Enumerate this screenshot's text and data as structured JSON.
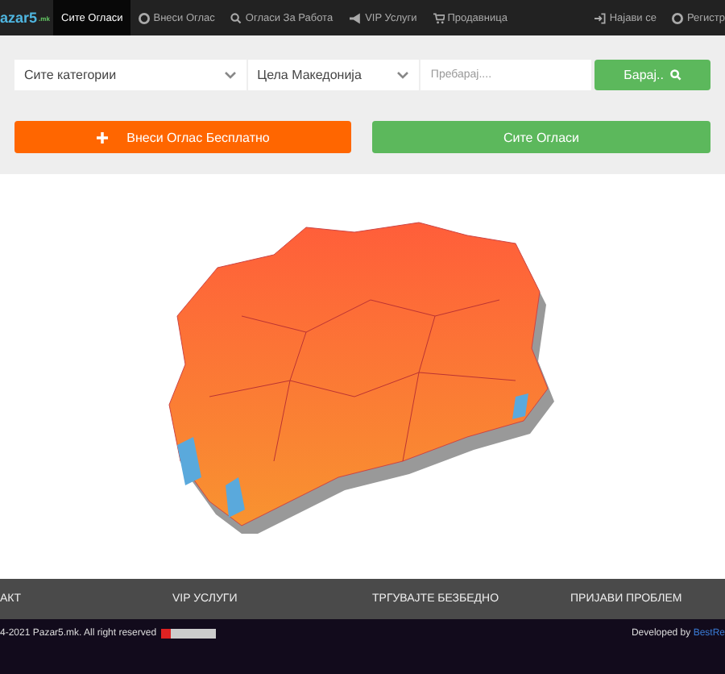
{
  "navbar": {
    "logo": "azar5",
    "logo_suffix": ".mk",
    "items": [
      {
        "label": "Сите Огласи",
        "selected": true
      },
      {
        "label": "Внеси Оглас",
        "selected": false
      },
      {
        "label": "Огласи За Работа",
        "selected": false
      },
      {
        "label": "VIP Услуги",
        "selected": false
      },
      {
        "label": "Продавница",
        "selected": false
      }
    ],
    "right_items": [
      {
        "label": "Најави се"
      },
      {
        "label": "Регистр"
      }
    ]
  },
  "search": {
    "category": "Сите категории",
    "region": "Цела Македонија",
    "placeholder": "Пребарај....",
    "button": "Барај.."
  },
  "actions": {
    "add": "Внеси Оглас Бесплатно",
    "all": "Сите Огласи"
  },
  "footer_links": [
    "АКТ",
    "VIP УСЛУГИ",
    "ТРГУВАЈТЕ БЕЗБЕДНО",
    "ПРИЈАВИ ПРОБЛЕМ"
  ],
  "bottom": {
    "copyright": "4-2021 Pazar5.mk. All right reserved",
    "developed": "Developed by",
    "developer": "BestRe"
  }
}
